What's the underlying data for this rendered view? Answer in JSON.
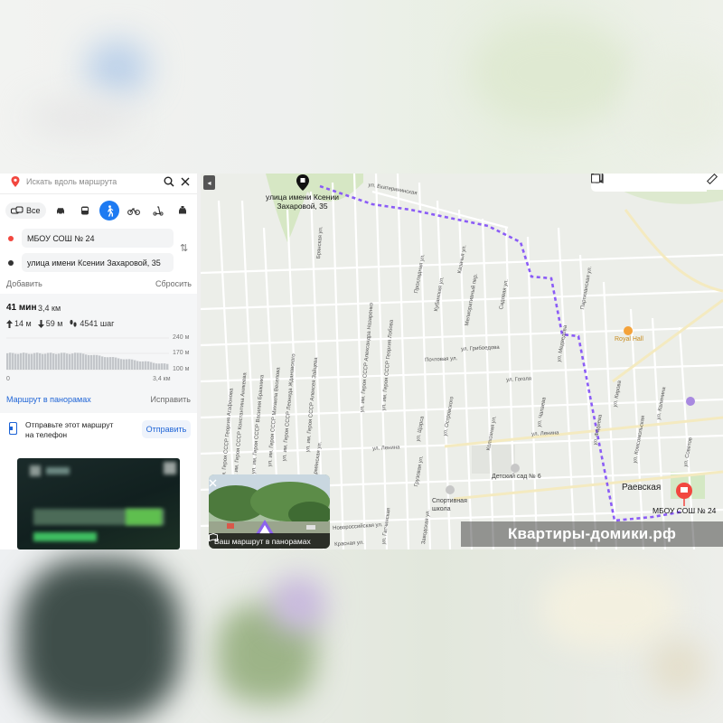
{
  "search": {
    "placeholder": "Искать вдоль маршрута"
  },
  "modes": {
    "all_label": "Все"
  },
  "route": {
    "from": "МБОУ СОШ № 24",
    "to": "улица имени Ксении Захаровой, 35",
    "add_label": "Добавить",
    "reset_label": "Сбросить"
  },
  "summary": {
    "time": "41 мин",
    "distance": "3,4 км",
    "ascent": "14 м",
    "descent": "59 м",
    "steps": "4541 шаг",
    "elev_top": "240 м",
    "elev_mid": "170 м",
    "elev_low": "100 м",
    "x_start": "0",
    "x_end": "3,4 км",
    "pano_link": "Маршрут в панорамах",
    "fix_label": "Исправить"
  },
  "send": {
    "text_line1": "Отправьте этот маршрут",
    "text_line2": "на телефон",
    "button": "Отправить"
  },
  "map": {
    "dest_label_line1": "улица имени Ксении",
    "dest_label_line2": "Захаровой, 35",
    "start_label": "МБОУ СОШ № 24",
    "town": "Раевская",
    "pois": {
      "royal": "Royal Hall",
      "kindergarten": "Детский сад № 6",
      "sport": "Спортивная школа"
    },
    "pano_caption": "Ваш маршрут в панорамах",
    "watermark": "Квартиры-домики.рф",
    "streets": {
      "ekaterininskaya": "ул. Екатерининская",
      "griboedova": "ул. Грибоедова",
      "pochtovaya": "Почтовая ул.",
      "gogolya": "ул. Гоголя",
      "lenina1": "ул. Ленина",
      "lenina2": "ул. Ленина",
      "kazachya": "Казачья ул.",
      "kubanskaya": "Кубанская ул.",
      "prohladnaya": "Прохладная ул.",
      "meliorativny": "Мелиоративный пер.",
      "sadovaya": "Садовая ул.",
      "medvedeva": "ул. Медведева",
      "partizanskaya": "Партизанская ул.",
      "ostrovskogo": "ул. Островского",
      "shorsa": "ул. Щорса",
      "gruzovaya": "Грузовая ул.",
      "kolhoznaya": "Колхозная ул.",
      "chapaeva": "ул. Чапаева",
      "fadeeva": "ул. Фадеева",
      "kirova": "ул. Кирова",
      "komsomolskaya": "ул. Комсомольская",
      "kalinina": "ул. Калинина",
      "sovetov": "ул. Советов",
      "bryanskaya": "Брянская ул.",
      "agafonova": "ул. им. Героя СССР Георгия Агафонова",
      "anikeeva": "ул. им. Героя СССР Константина Аникеева",
      "brazhnika": "ул. им. Героя СССР Василия Бражника",
      "veselova": "ул. им. Героя СССР Михаила Веселова",
      "zhdanovskogo": "ул. им. Героя СССР Леонида Ждановского",
      "zaitseva": "ул. им. Героя СССР Алексея Зайцева",
      "nazarenko": "ул. им. Героя СССР Александра Назаренко",
      "lobova": "ул. им. Героя СССР Георгия Лобова",
      "krasnaya": "Красная ул.",
      "geroya_arm": "Армянская ул.",
      "gatchinskaya": "ул. Гатчинская",
      "zavodskaya": "Заводская ул.",
      "novoroseiskaya": "Новороссийская ул."
    }
  },
  "colors": {
    "route": "#8b5cf6",
    "accent": "#1e7bf2",
    "pin": "#f2473f",
    "link": "#1e64d6"
  },
  "icons": [
    "location-pin-icon",
    "search-icon",
    "close-icon",
    "car-transit-icon",
    "car-icon",
    "bus-icon",
    "walk-icon",
    "bike-icon",
    "scooter-icon",
    "taxi-icon",
    "swap-icon",
    "arrow-up-icon",
    "arrow-down-icon",
    "footsteps-icon",
    "phone-icon",
    "layers-icon",
    "panorama-icon",
    "camera-icon",
    "transport-icon",
    "map-layers-icon",
    "ruler-icon"
  ]
}
